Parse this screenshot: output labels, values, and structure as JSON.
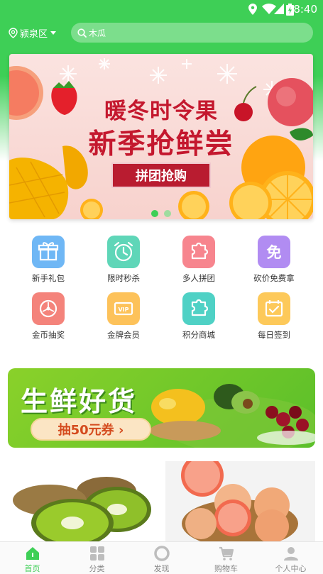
{
  "status_bar": {
    "time": "8:40"
  },
  "header": {
    "location": "颍泉区",
    "search_text": "木瓜"
  },
  "banner": {
    "line1": "暖冬时令果",
    "line2": "新季抢鲜尝",
    "tag": "拼团抢购",
    "slide_count": 2,
    "active_slide": 1
  },
  "grid": [
    {
      "label": "新手礼包",
      "icon": "gift-icon",
      "color": "#6fb7f5"
    },
    {
      "label": "限时秒杀",
      "icon": "alarm-clock-icon",
      "color": "#5fd6b8"
    },
    {
      "label": "多人拼团",
      "icon": "puzzle-icon",
      "color": "#f7858e"
    },
    {
      "label": "砍价免费拿",
      "icon": "free-icon",
      "color": "#b18cf2"
    },
    {
      "label": "金币抽奖",
      "icon": "lottery-wheel-icon",
      "color": "#f4837b"
    },
    {
      "label": "金牌会员",
      "icon": "vip-card-icon",
      "color": "#fdc25a"
    },
    {
      "label": "积分商城",
      "icon": "puzzle-icon",
      "color": "#4fd1c5"
    },
    {
      "label": "每日签到",
      "icon": "calendar-check-icon",
      "color": "#fdc95a"
    }
  ],
  "promo": {
    "title": "生鲜好货",
    "button": "抽50元券 ›"
  },
  "tabs": [
    {
      "label": "首页",
      "icon": "home-icon",
      "active": true
    },
    {
      "label": "分类",
      "icon": "category-grid-icon",
      "active": false
    },
    {
      "label": "发现",
      "icon": "discover-icon",
      "active": false
    },
    {
      "label": "购物车",
      "icon": "cart-icon",
      "active": false
    },
    {
      "label": "个人中心",
      "icon": "user-icon",
      "active": false
    }
  ],
  "colors": {
    "brand_green": "#3ecf56",
    "banner_red": "#c4182e"
  }
}
